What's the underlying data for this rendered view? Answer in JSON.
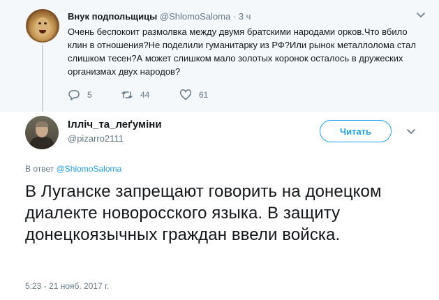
{
  "parent_tweet": {
    "author_name": "Внук подпольщицы",
    "author_handle": "@ShlomoSaloma",
    "separator": "·",
    "time": "3 ч",
    "text": "Очень беспокоит размолвка между двумя братскими народами орков.Что вбило клин в отношения?Не поделили гуманитарку из РФ?Или рынок металлолома стал слишком тесен?А может слишком мало золотых коронок осталось в дружеских организмах двух народов?",
    "replies": "5",
    "retweets": "44",
    "likes": "61"
  },
  "main_tweet": {
    "author_name": "Ілліч_та_леґуміни",
    "author_handle": "@pizarro2111",
    "follow_label": "Читать",
    "reply_prefix": "В ответ",
    "reply_mention": "@ShlomoSaloma",
    "text": "В Луганске запрещают говорить на донецком диалекте новоросского языка. В защиту донецкоязычных граждан ввели войска.",
    "timestamp": "5:23 - 21 нояб. 2017 г."
  },
  "colors": {
    "accent": "#1da1f2",
    "muted": "#657786",
    "text": "#14171a",
    "parent_bg": "#f5f8fa"
  },
  "icons": [
    "reply-icon",
    "retweet-icon",
    "like-icon",
    "chevron-down-icon"
  ]
}
